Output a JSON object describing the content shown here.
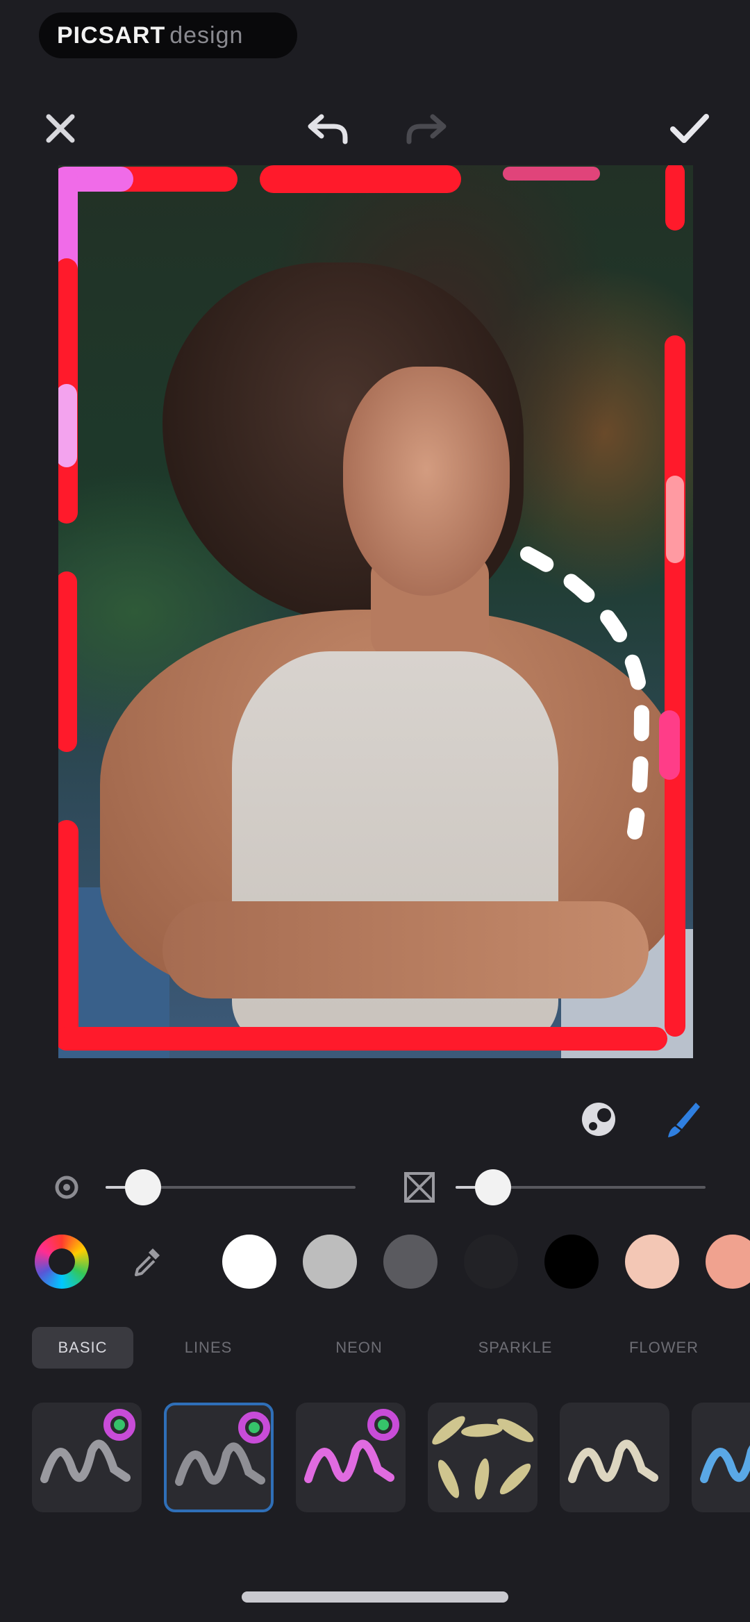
{
  "watermark": {
    "bold": "PICSART",
    "light": "design"
  },
  "topbar": {
    "close_icon": "close-icon",
    "undo_icon": "undo-icon",
    "redo_icon": "redo-icon",
    "done_icon": "checkmark-icon"
  },
  "tools": {
    "mask_icon": "mask-icon",
    "brush_icon": "brush-icon"
  },
  "sliders": {
    "size": {
      "icon": "brush-size-icon",
      "value": 0.15
    },
    "opacity": {
      "icon": "opacity-icon",
      "value": 0.15
    }
  },
  "colors": {
    "wheel_icon": "color-wheel-icon",
    "picker_icon": "eyedropper-icon",
    "swatches": [
      "#ffffff",
      "#bdbdbd",
      "#5a5a5f",
      "#222226",
      "#000000",
      "#f3c7b5",
      "#f0a28f"
    ],
    "accent": "#2f6fb8"
  },
  "tabs": [
    {
      "label": "BASIC",
      "active": true
    },
    {
      "label": "LINES",
      "active": false
    },
    {
      "label": "NEON",
      "active": false
    },
    {
      "label": "SPARKLE",
      "active": false
    },
    {
      "label": "FLOWER",
      "active": false
    }
  ],
  "brushes": [
    {
      "name": "brush-basic-gray",
      "color": "#9a9aa0",
      "rainbow_badge": true,
      "selected": false
    },
    {
      "name": "brush-basic-selected",
      "color": "#8f8f95",
      "rainbow_badge": true,
      "selected": true
    },
    {
      "name": "brush-basic-pink",
      "color": "#e06be0",
      "rainbow_badge": true,
      "selected": false
    },
    {
      "name": "brush-leaves",
      "color": "#cfc58f",
      "rainbow_badge": false,
      "selected": false
    },
    {
      "name": "brush-cream",
      "color": "#ddd6c0",
      "rainbow_badge": false,
      "selected": false
    },
    {
      "name": "brush-blue",
      "color": "#5aa8e6",
      "rainbow_badge": false,
      "selected": false
    }
  ]
}
